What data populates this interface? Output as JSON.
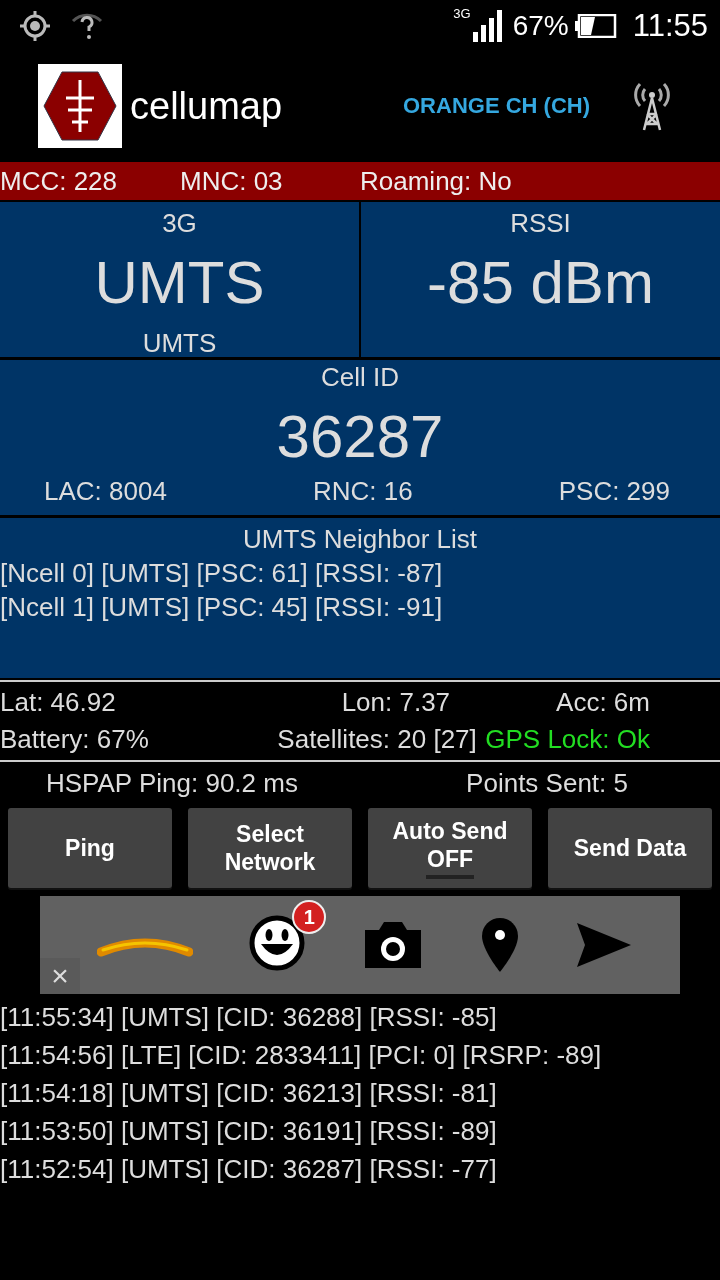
{
  "status_bar": {
    "network_type": "3G",
    "battery": "67%",
    "time": "11:55"
  },
  "header": {
    "app_name": "cellumap",
    "operator": "ORANGE CH (CH)"
  },
  "network_bar": {
    "mcc": "MCC: 228",
    "mnc": "MNC: 03",
    "roaming": "Roaming: No"
  },
  "technology": {
    "label": "3G",
    "value": "UMTS",
    "sub": "UMTS"
  },
  "rssi": {
    "label": "RSSI",
    "value": "-85 dBm"
  },
  "cell": {
    "label": "Cell ID",
    "value": "36287",
    "details": [
      "LAC: 8004",
      "RNC: 16",
      "PSC: 299"
    ]
  },
  "neighbors": {
    "title": "UMTS Neighbor List",
    "items": [
      "[Ncell 0] [UMTS] [PSC: 61] [RSSI: -87]",
      "[Ncell 1] [UMTS] [PSC: 45] [RSSI: -91]"
    ]
  },
  "gps": {
    "lat": "Lat: 46.92",
    "lon": "Lon: 7.37",
    "acc": "Acc: 6m",
    "battery": "Battery: 67%",
    "satellites": "Satellites: 20 [27]",
    "lock": "GPS Lock: Ok",
    "lock_ok": true
  },
  "stats": {
    "ping": "HSPAP Ping: 90.2 ms",
    "points": "Points Sent: 5"
  },
  "buttons": [
    {
      "kind": "plain",
      "label": "Ping"
    },
    {
      "kind": "plain",
      "label": "Select Network"
    },
    {
      "kind": "toggle",
      "label": "Auto Send",
      "state": "OFF",
      "on": false
    },
    {
      "kind": "plain",
      "label": "Send Data"
    }
  ],
  "ad_bar": {
    "badge": "1",
    "close": "×"
  },
  "log": [
    "[11:55:34] [UMTS] [CID: 36288] [RSSI: -85]",
    "[11:54:56] [LTE] [CID: 2833411] [PCI: 0] [RSRP: -89]",
    "[11:54:18] [UMTS] [CID: 36213] [RSSI: -81]",
    "[11:53:50] [UMTS] [CID: 36191] [RSSI: -89]",
    "[11:52:54] [UMTS] [CID: 36287] [RSSI: -77]"
  ]
}
